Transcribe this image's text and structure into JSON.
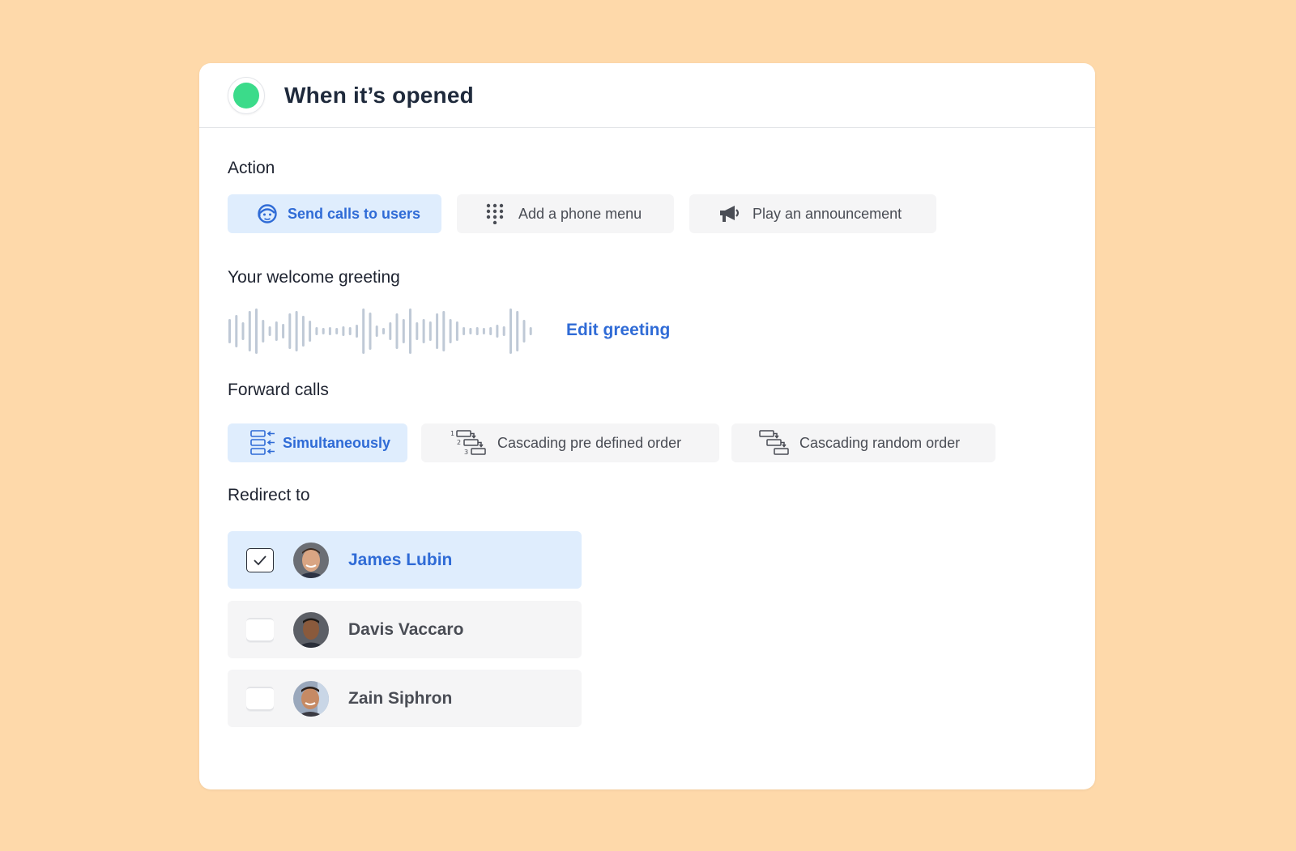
{
  "header": {
    "title": "When it’s opened",
    "status_color": "#3BDB8A"
  },
  "action": {
    "label": "Action",
    "options": [
      {
        "label": "Send calls to users",
        "icon": "user-face-icon",
        "selected": true
      },
      {
        "label": "Add a phone menu",
        "icon": "keypad-icon",
        "selected": false
      },
      {
        "label": "Play an announcement",
        "icon": "megaphone-icon",
        "selected": false
      }
    ]
  },
  "greeting": {
    "label": "Your welcome greeting",
    "icon": "audio-waveform-icon",
    "edit_label": "Edit greeting"
  },
  "forward": {
    "label": "Forward calls",
    "options": [
      {
        "label": "Simultaneously",
        "icon": "simultaneous-icon",
        "selected": true
      },
      {
        "label": "Cascading pre defined order",
        "icon": "cascade-ordered-icon",
        "selected": false
      },
      {
        "label": "Cascading random order",
        "icon": "cascade-random-icon",
        "selected": false
      }
    ]
  },
  "redirect": {
    "label": "Redirect to",
    "users": [
      {
        "name": "James Lubin",
        "checked": true
      },
      {
        "name": "Davis Vaccaro",
        "checked": false
      },
      {
        "name": "Zain Siphron",
        "checked": false
      }
    ]
  },
  "colors": {
    "background": "#FED9AA",
    "accent": "#2F6BD6",
    "selected_bg": "#DFEDFD",
    "option_bg": "#F5F5F6"
  }
}
